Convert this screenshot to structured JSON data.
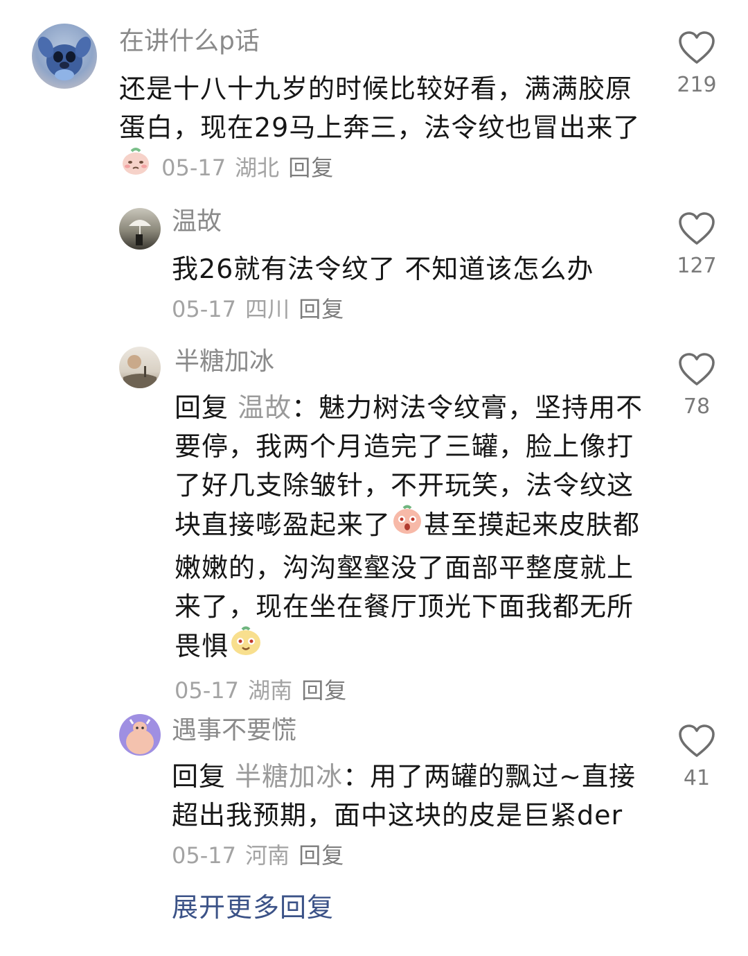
{
  "comments": [
    {
      "username": "在讲什么p话",
      "text": "还是十八十九岁的时候比较好看，满满胶原蛋白，现在29马上奔三，法令纹也冒出来了",
      "date": "05-17",
      "location": "湖北",
      "reply_label": "回复",
      "likes": "219",
      "avatar_icon": "stitch-avatar",
      "emoji_icon": "crying-face-emoji"
    },
    {
      "username": "温故",
      "text": "我26就有法令纹了 不知道该怎么办",
      "date": "05-17",
      "location": "四川",
      "reply_label": "回复",
      "likes": "127",
      "avatar_icon": "umbrella-photo-avatar"
    },
    {
      "username": "半糖加冰",
      "reply_prefix": "回复",
      "reply_to": "温故",
      "colon": "：",
      "text_part1": "魅力树法令纹膏，坚持用不要停，我两个月造完了三罐，脸上像打了好几支除皱针，不开玩笑，法令纹这块直接嘭盈起来了",
      "text_part2": "甚至摸起来皮肤都嫩嫩的，沟沟壑壑没了面部平整度就上来了，现在坐在餐厅顶光下面我都无所畏惧",
      "date": "05-17",
      "location": "湖南",
      "reply_label": "回复",
      "likes": "78",
      "avatar_icon": "landscape-painting-avatar",
      "emoji_icons": [
        "surprised-face-emoji",
        "cute-face-emoji"
      ]
    },
    {
      "username": "遇事不要慌",
      "reply_prefix": "回复",
      "reply_to": "半糖加冰",
      "colon": "：",
      "text": "用了两罐的飘过~直接超出我预期，面中这块的皮是巨紧der",
      "date": "05-17",
      "location": "河南",
      "reply_label": "回复",
      "likes": "41",
      "avatar_icon": "cartoon-cow-avatar"
    }
  ],
  "expand_more": "展开更多回复",
  "colors": {
    "username": "#8a8a8a",
    "meta": "#a3a3a3",
    "link": "#3b5287",
    "text": "#161616"
  }
}
